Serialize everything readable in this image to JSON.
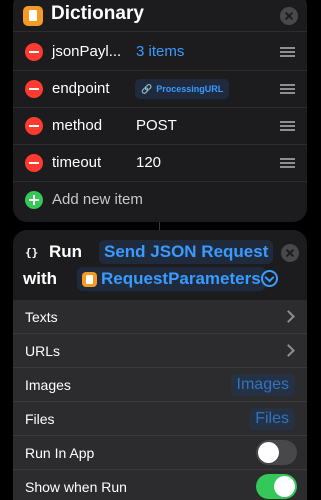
{
  "dictionary": {
    "title": "Dictionary",
    "items": [
      {
        "key": "jsonPayl...",
        "value": "3 items",
        "type": "link"
      },
      {
        "key": "endpoint",
        "value": "ProcessingURL",
        "type": "variable"
      },
      {
        "key": "method",
        "value": "POST",
        "type": "text"
      },
      {
        "key": "timeout",
        "value": "120",
        "type": "text"
      }
    ],
    "add_label": "Add new item"
  },
  "run_action": {
    "verb": "Run",
    "shortcut": "Send JSON Request",
    "with_word": "with",
    "parameter": "RequestParameters"
  },
  "settings": {
    "rows": [
      {
        "label": "Texts"
      },
      {
        "label": "URLs"
      },
      {
        "label": "Images",
        "value": "Images"
      },
      {
        "label": "Files",
        "value": "Files"
      },
      {
        "label": "Run In App",
        "toggle": false
      },
      {
        "label": "Show when Run",
        "toggle": true
      }
    ]
  },
  "colors": {
    "accent": "#3a9bff",
    "delete": "#ff3b30",
    "add": "#34c759",
    "dictionary_icon": "#f59b23"
  },
  "icons": {
    "dictionary": "dictionary-icon",
    "remove": "minus-circle-icon",
    "add": "plus-circle-icon",
    "reorder": "drag-handle-icon",
    "close": "close-icon",
    "run": "braces-icon",
    "expand": "chevron-down-circle-icon",
    "disclosure": "chevron-right-icon",
    "link": "link-icon"
  }
}
